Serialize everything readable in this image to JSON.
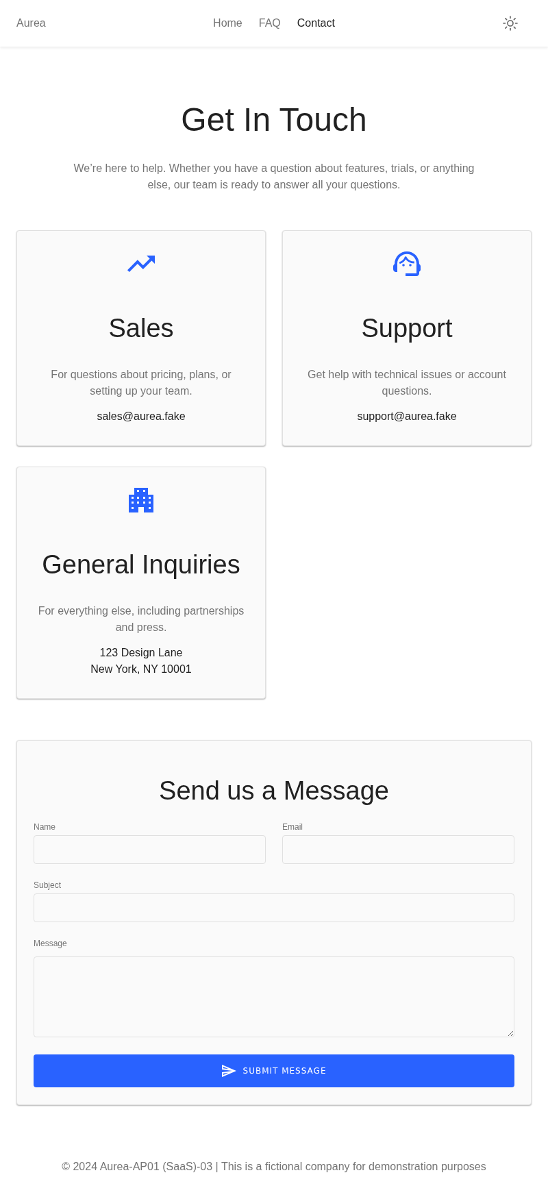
{
  "header": {
    "brand": "Aurea",
    "nav": [
      {
        "label": "Home",
        "selected": false
      },
      {
        "label": "FAQ",
        "selected": false
      },
      {
        "label": "Contact",
        "selected": true
      }
    ]
  },
  "hero": {
    "title": "Get In Touch",
    "subtitle": "We’re here to help. Whether you have a question about features, trials, or anything else, our team is ready to answer all your questions."
  },
  "contact_cards": [
    {
      "title": "Sales",
      "description": "For questions about pricing, plans, or setting up your team.",
      "details": [
        "sales@aurea.fake"
      ]
    },
    {
      "title": "Support",
      "description": "Get help with technical issues or account questions.",
      "details": [
        "support@aurea.fake"
      ]
    },
    {
      "title": "General Inquiries",
      "description": "For everything else, including partnerships and press.",
      "details": [
        "123 Design Lane",
        "New York, NY 10001"
      ]
    }
  ],
  "message_form": {
    "title": "Send us a Message",
    "rows": [
      {
        "fields": [
          {
            "kind": "input",
            "label": "Name"
          },
          {
            "kind": "input",
            "label": "Email"
          }
        ]
      },
      {
        "fields": [
          {
            "kind": "input",
            "label": "Subject"
          }
        ]
      },
      {
        "fields": [
          {
            "kind": "textarea",
            "label": "Message"
          }
        ]
      }
    ],
    "submit_button": "SUBMIT MESSAGE"
  },
  "footer": {
    "text": "© 2024 Aurea-AP01 (SaaS)-03 | This is a fictional company for demonstration purposes"
  }
}
